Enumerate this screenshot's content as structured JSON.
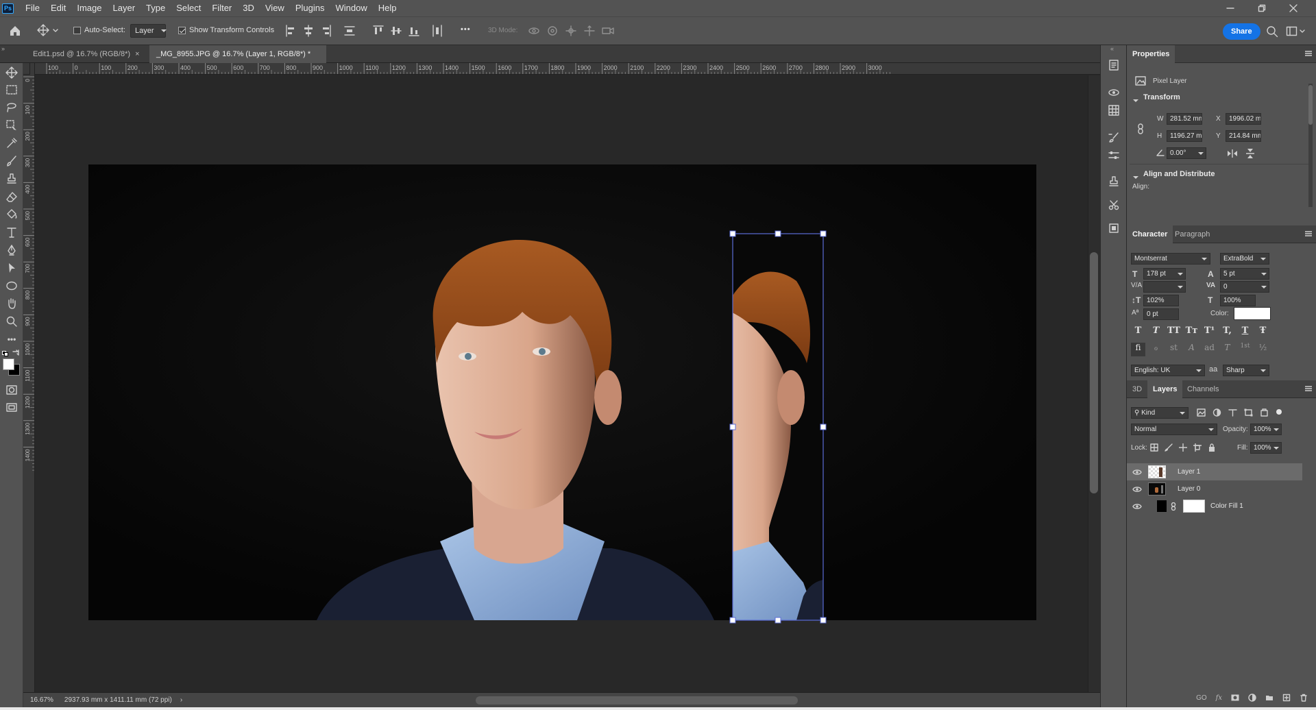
{
  "app": {
    "logo_text": "Ps"
  },
  "menu": [
    "File",
    "Edit",
    "Image",
    "Layer",
    "Type",
    "Select",
    "Filter",
    "3D",
    "View",
    "Plugins",
    "Window",
    "Help"
  ],
  "options": {
    "auto_select_label": "Auto-Select:",
    "auto_select_checked": false,
    "auto_select_target": "Layer",
    "transform_controls_label": "Show Transform Controls",
    "transform_controls_checked": true,
    "mode_3d_label": "3D Mode:",
    "more_label": "•••",
    "share_label": "Share"
  },
  "tabs": [
    {
      "label": "Edit1.psd @ 16.7% (RGB/8*)",
      "close": "×"
    },
    {
      "label": "_MG_8955.JPG @ 16.7% (Layer 1, RGB/8*) *",
      "close": "×",
      "active": true
    }
  ],
  "rulers": {
    "h_labels": [
      "100",
      "0",
      "100",
      "200",
      "300",
      "400",
      "500",
      "600",
      "700",
      "800",
      "900",
      "1000",
      "1100",
      "1200",
      "1300",
      "1400",
      "1500",
      "1600",
      "1700",
      "1800",
      "1900",
      "2000",
      "2100",
      "2200",
      "2300",
      "2400",
      "2500",
      "2600",
      "2700",
      "2800",
      "2900",
      "3000"
    ],
    "v_labels": [
      "0",
      "100",
      "200",
      "300",
      "400",
      "500",
      "600",
      "700",
      "800",
      "900",
      "1000",
      "1100",
      "1200",
      "1300",
      "1400"
    ]
  },
  "status": {
    "zoom": "16.67%",
    "doc_info": "2937.93 mm x 1411.11 mm (72 ppi)",
    "arrow": "›"
  },
  "properties": {
    "title": "Properties",
    "kind": "Pixel Layer",
    "transform_title": "Transform",
    "w_label": "W",
    "w": "281.52 mm",
    "h_label": "H",
    "h": "1196.27 mi",
    "x_label": "X",
    "x": "1996.02 mi",
    "y_label": "Y",
    "y": "214.84 mm",
    "angle": "0.00°",
    "align_title": "Align and Distribute",
    "align_label": "Align:"
  },
  "character": {
    "tab_character": "Character",
    "tab_paragraph": "Paragraph",
    "font": "Montserrat",
    "style": "ExtraBold",
    "size": "178 pt",
    "leading": "5 pt",
    "kerning": "",
    "tracking": "0",
    "vscale": "102%",
    "hscale": "100%",
    "baseline": "0 pt",
    "color_label": "Color:",
    "color": "#ffffff",
    "language": "English: UK",
    "aa_label": "aa",
    "antialias": "Sharp",
    "style_buttons": [
      "T",
      "T",
      "TT",
      "Tт",
      "T¹",
      "T,",
      "T",
      "Ŧ"
    ],
    "ot_buttons": [
      "fi",
      "ℴ",
      "st",
      "A",
      "ad",
      "T",
      "1st",
      "½"
    ]
  },
  "layers": {
    "tab_3d": "3D",
    "tab_layers": "Layers",
    "tab_channels": "Channels",
    "kind_label": "Kind",
    "blend_mode": "Normal",
    "opacity_label": "Opacity:",
    "opacity": "100%",
    "lock_label": "Lock:",
    "fill_label": "Fill:",
    "fill": "100%",
    "items": [
      {
        "name": "Layer 1",
        "selected": true
      },
      {
        "name": "Layer 0",
        "selected": false
      },
      {
        "name": "Color Fill 1",
        "selected": false
      }
    ],
    "footer_link": "GO",
    "footer_fx": "fx"
  },
  "colors": {
    "accent": "#1473e6",
    "selection": "#5b6cd6",
    "chrome": "#535353",
    "workspace": "#282828"
  }
}
